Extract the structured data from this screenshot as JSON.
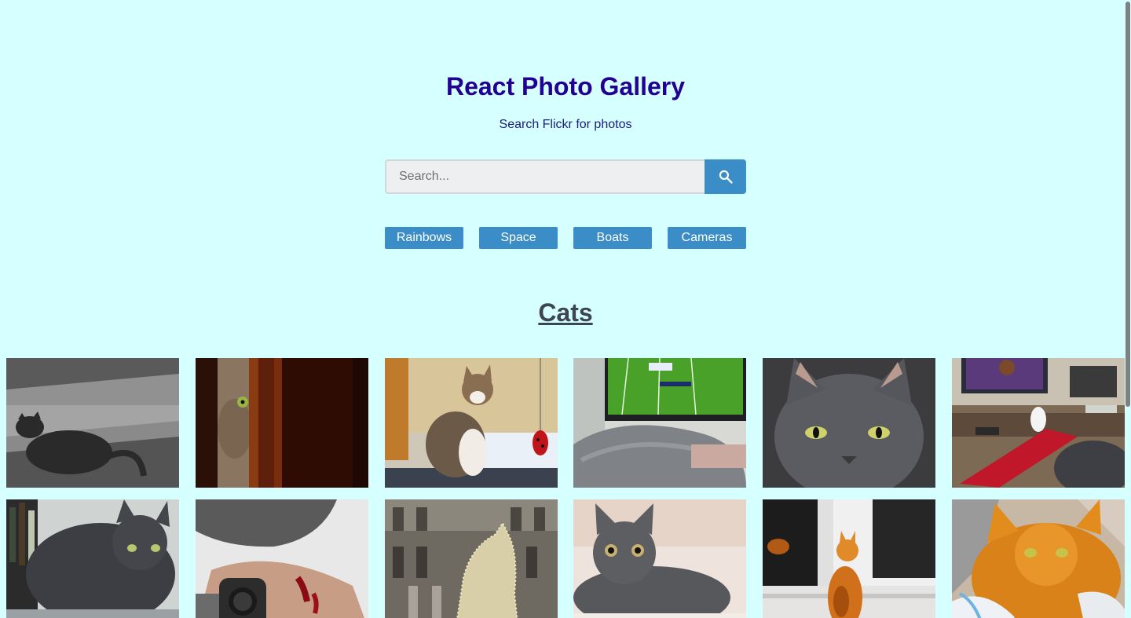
{
  "header": {
    "title": "React Photo Gallery",
    "subtitle": "Search Flickr for photos"
  },
  "search": {
    "placeholder": "Search...",
    "value": "",
    "button_icon": "search-icon"
  },
  "nav": {
    "items": [
      {
        "label": "Rainbows"
      },
      {
        "label": "Space"
      },
      {
        "label": "Boats"
      },
      {
        "label": "Cameras"
      }
    ]
  },
  "gallery": {
    "heading": "Cats",
    "photos": [
      {
        "subject": "black-and-white-cat-in-grass"
      },
      {
        "subject": "cat-peeking-behind-door"
      },
      {
        "subject": "calico-cat-with-ladybug-ornament"
      },
      {
        "subject": "gray-cat-watching-football-on-tv"
      },
      {
        "subject": "gray-cat-closeup"
      },
      {
        "subject": "gray-cat-on-couch-with-tv"
      },
      {
        "subject": "gray-cat-on-windowsill"
      },
      {
        "subject": "cat-and-scratched-hand"
      },
      {
        "subject": "lighted-cat-sculpture-by-building"
      },
      {
        "subject": "gray-cat-lying-down"
      },
      {
        "subject": "orange-cat-at-window"
      },
      {
        "subject": "orange-cat-on-blanket"
      }
    ]
  },
  "colors": {
    "background": "#d6ffff",
    "title": "#210092",
    "accent": "#3a8dc7",
    "section_title": "#3c4553"
  }
}
